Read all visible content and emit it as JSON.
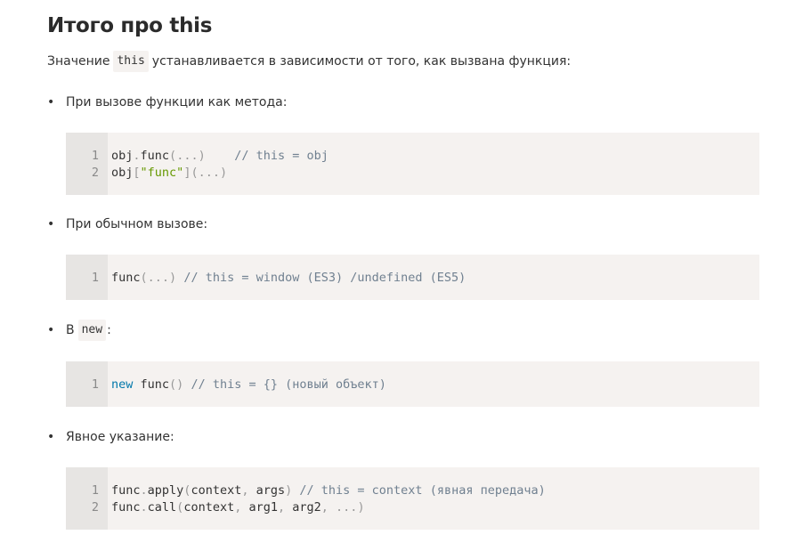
{
  "title": "Итого про this",
  "intro": {
    "before": "Значение",
    "code": "this",
    "after": "устанавливается в зависимости от того, как вызвана функция:"
  },
  "sections": [
    {
      "bullet": "При вызове функции как метода:",
      "lines": [
        {
          "num": "1",
          "tokens": [
            {
              "t": "obj",
              "c": "plain"
            },
            {
              "t": ".",
              "c": "punct"
            },
            {
              "t": "func",
              "c": "plain"
            },
            {
              "t": "(",
              "c": "punct"
            },
            {
              "t": "...",
              "c": "punct"
            },
            {
              "t": ")",
              "c": "punct"
            },
            {
              "t": "    // this = obj",
              "c": "cmt"
            }
          ]
        },
        {
          "num": "2",
          "tokens": [
            {
              "t": "obj",
              "c": "plain"
            },
            {
              "t": "[",
              "c": "punct"
            },
            {
              "t": "\"func\"",
              "c": "str"
            },
            {
              "t": "]",
              "c": "punct"
            },
            {
              "t": "(",
              "c": "punct"
            },
            {
              "t": "...",
              "c": "punct"
            },
            {
              "t": ")",
              "c": "punct"
            }
          ]
        }
      ]
    },
    {
      "bullet": "При обычном вызове:",
      "lines": [
        {
          "num": "1",
          "tokens": [
            {
              "t": "func",
              "c": "plain"
            },
            {
              "t": "(",
              "c": "punct"
            },
            {
              "t": "...",
              "c": "punct"
            },
            {
              "t": ")",
              "c": "punct"
            },
            {
              "t": " // this = window (ES3) /undefined (ES5)",
              "c": "cmt"
            }
          ]
        }
      ]
    },
    {
      "bullet": "В",
      "bullet_code": "new",
      "bullet_after": ":",
      "lines": [
        {
          "num": "1",
          "tokens": [
            {
              "t": "new",
              "c": "kw"
            },
            {
              "t": " func",
              "c": "plain"
            },
            {
              "t": "(",
              "c": "punct"
            },
            {
              "t": ")",
              "c": "punct"
            },
            {
              "t": " // this = {} (новый объект)",
              "c": "cmt"
            }
          ]
        }
      ]
    },
    {
      "bullet": "Явное указание:",
      "lines": [
        {
          "num": "1",
          "tokens": [
            {
              "t": "func",
              "c": "plain"
            },
            {
              "t": ".",
              "c": "punct"
            },
            {
              "t": "apply",
              "c": "plain"
            },
            {
              "t": "(",
              "c": "punct"
            },
            {
              "t": "context",
              "c": "plain"
            },
            {
              "t": ",",
              "c": "punct"
            },
            {
              "t": " args",
              "c": "plain"
            },
            {
              "t": ")",
              "c": "punct"
            },
            {
              "t": " // this = context (явная передача)",
              "c": "cmt"
            }
          ]
        },
        {
          "num": "2",
          "tokens": [
            {
              "t": "func",
              "c": "plain"
            },
            {
              "t": ".",
              "c": "punct"
            },
            {
              "t": "call",
              "c": "plain"
            },
            {
              "t": "(",
              "c": "punct"
            },
            {
              "t": "context",
              "c": "plain"
            },
            {
              "t": ",",
              "c": "punct"
            },
            {
              "t": " arg1",
              "c": "plain"
            },
            {
              "t": ",",
              "c": "punct"
            },
            {
              "t": " arg2",
              "c": "plain"
            },
            {
              "t": ",",
              "c": "punct"
            },
            {
              "t": " ...",
              "c": "punct"
            },
            {
              "t": ")",
              "c": "punct"
            }
          ]
        }
      ]
    }
  ],
  "colors": {
    "code_bg": "#f5f2f0",
    "gutter_bg": "#e7e5e3",
    "string": "#669900",
    "keyword": "#0077aa",
    "comment": "#708090",
    "punctuation": "#999999"
  }
}
